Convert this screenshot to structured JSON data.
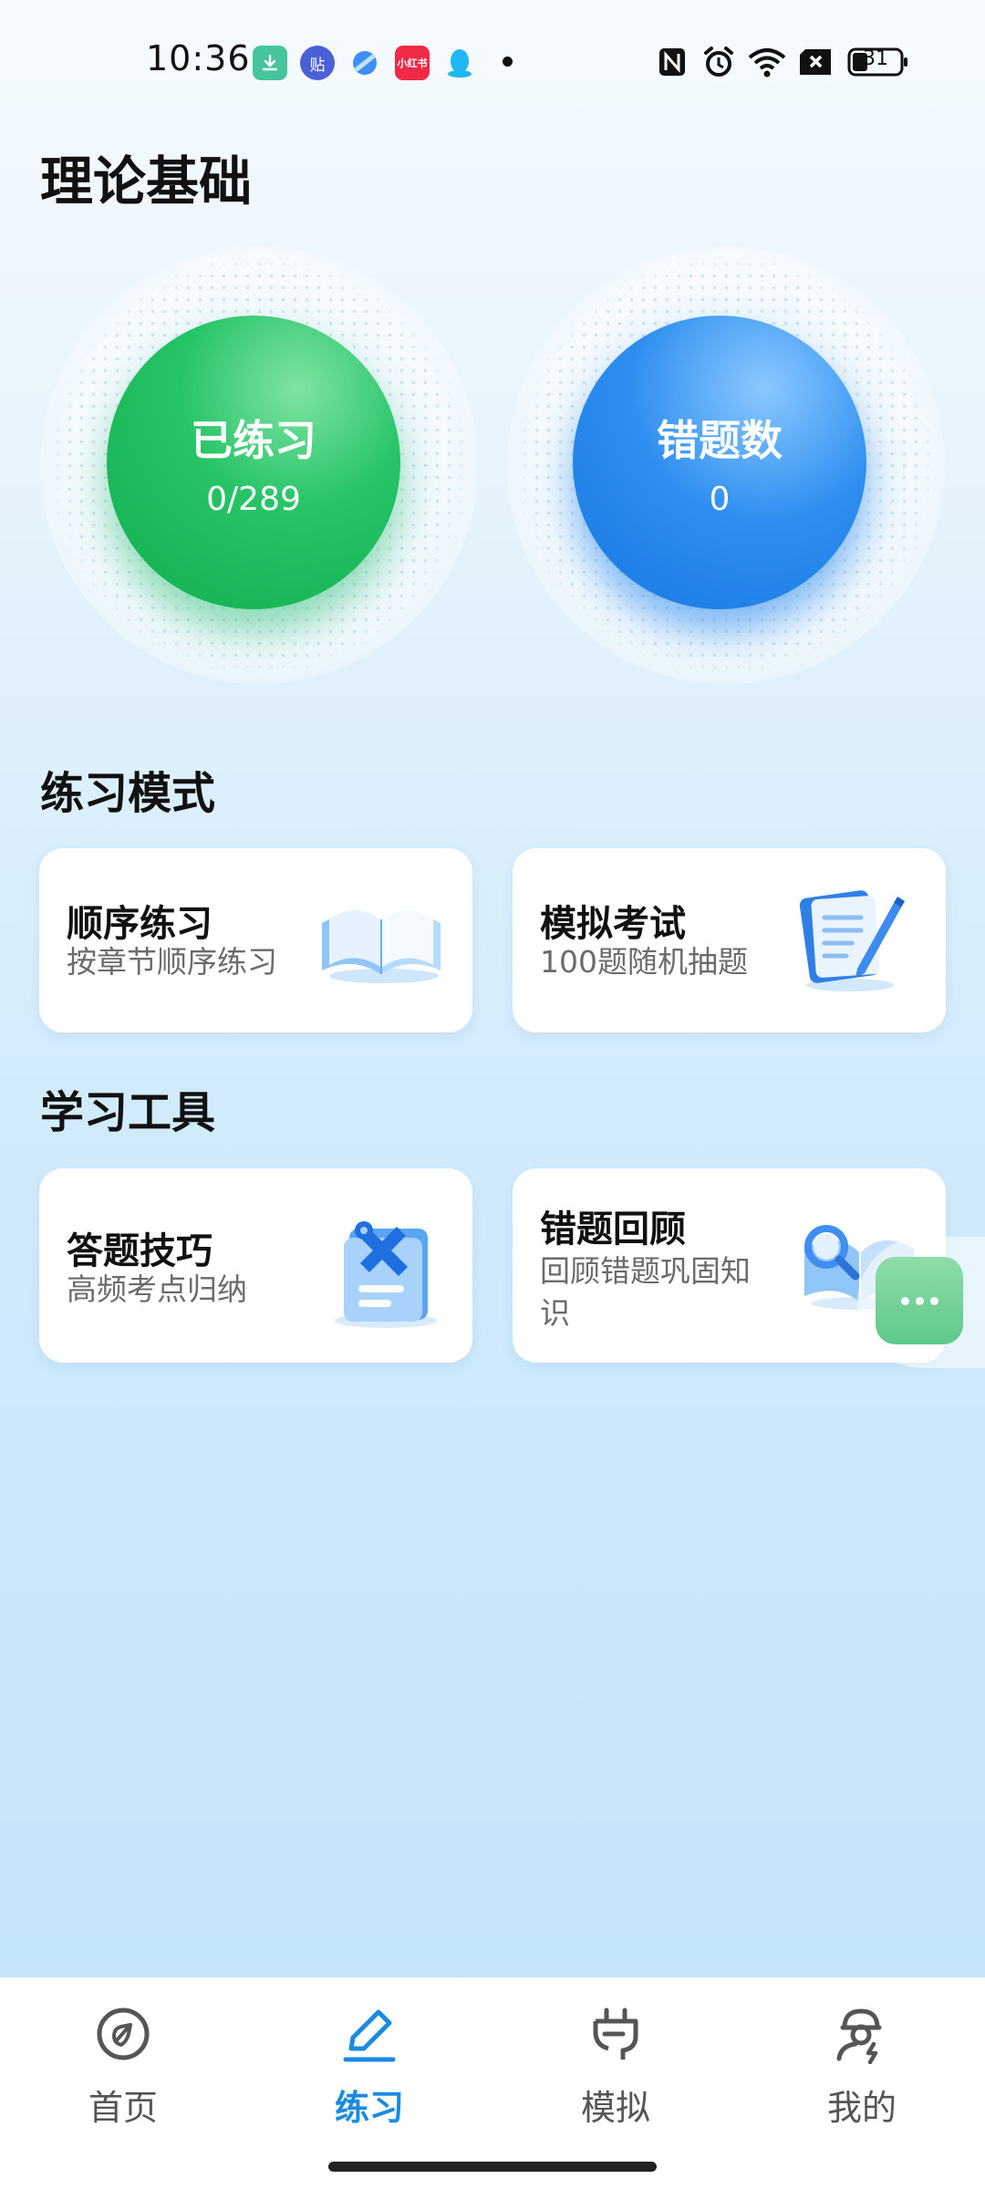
{
  "status_bar": {
    "time": "10:36",
    "notification_icons": [
      "download-icon",
      "tieba-icon",
      "browser-icon",
      "xiaohongshu-icon",
      "qq-icon"
    ],
    "tieba_text": "贴",
    "xhs_text": "小红书",
    "system_icons": [
      "nfc-icon",
      "alarm-icon",
      "wifi-icon",
      "no-sim-icon",
      "battery-icon"
    ],
    "battery": "31"
  },
  "page": {
    "title": "理论基础"
  },
  "stats": {
    "practiced": {
      "label": "已练习",
      "value": "0/289"
    },
    "mistakes": {
      "label": "错题数",
      "value": "0"
    }
  },
  "practice_mode": {
    "title": "练习模式",
    "cards": [
      {
        "title": "顺序练习",
        "subtitle": "按章节顺序练习",
        "icon": "open-book-icon"
      },
      {
        "title": "模拟考试",
        "subtitle": "100题随机抽题",
        "icon": "exam-paper-pen-icon"
      }
    ]
  },
  "study_tools": {
    "title": "学习工具",
    "cards": [
      {
        "title": "答题技巧",
        "subtitle": "高频考点归纳",
        "icon": "document-wrench-icon"
      },
      {
        "title": "错题回顾",
        "subtitle": "回顾错题巩固知识",
        "subtitle_line1": "回顾错题巩固知",
        "subtitle_line2": "识",
        "icon": "book-magnifier-icon"
      }
    ]
  },
  "floating_button": {
    "icon": "more-dots-icon"
  },
  "bottom_nav": {
    "active": "练习",
    "items": [
      {
        "label": "首页",
        "icon": "home-icon"
      },
      {
        "label": "练习",
        "icon": "pencil-icon"
      },
      {
        "label": "模拟",
        "icon": "simulate-icon"
      },
      {
        "label": "我的",
        "icon": "profile-icon"
      }
    ]
  },
  "colors": {
    "accent": "#1a8be0",
    "green_circle": "#1cb85a",
    "blue_circle": "#2486ea",
    "nav_active": "#1a8be0"
  }
}
